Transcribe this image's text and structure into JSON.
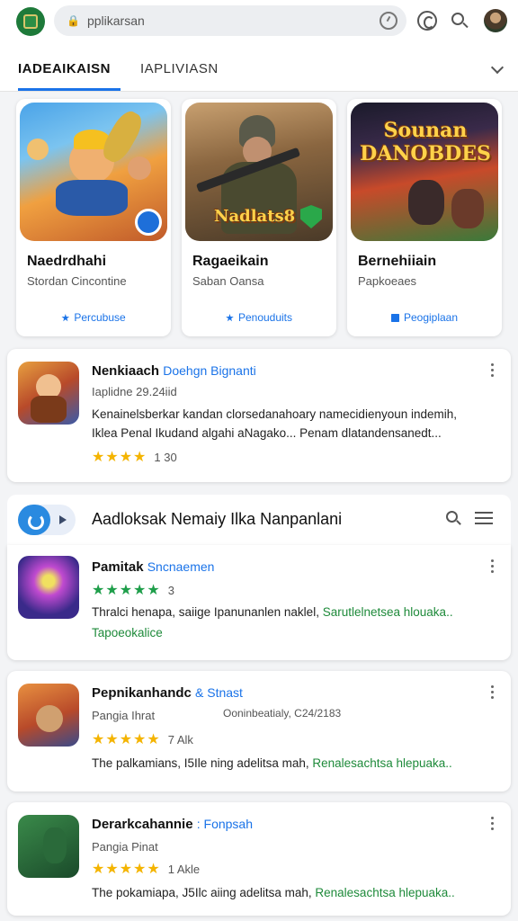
{
  "header": {
    "url": "pplikarsan"
  },
  "tabs": [
    {
      "label": "IADEAIKAISN"
    },
    {
      "label": "IAPLIVIASN"
    }
  ],
  "featured": [
    {
      "name": "Naedrdhahi",
      "sub": "Stordan Cincontine",
      "popular": "Percubuse",
      "icon": "star-icon",
      "art_title": ""
    },
    {
      "name": "Ragaeikain",
      "sub": "Saban Oansa",
      "popular": "Penouduits",
      "icon": "star-icon",
      "art_title": "Nadlats8"
    },
    {
      "name": "Bernehiiain",
      "sub": "Papkoeaes",
      "popular": "Peogiplaan",
      "icon": "grid-icon",
      "art_title": "Sounan DANOBDES"
    }
  ],
  "list_top": {
    "title": "Nenkiaach",
    "developer": "Doehgn Bignanti",
    "meta": "Iaplidne 29.24iid",
    "desc_line1": "Kenainelsberkar kandan clorsedanahoary namecidienyoun indemih,",
    "desc_line2": "Iklea Penal Ikudand algahi aNagako... Penam dlatandensanedt...",
    "stars": "★★★★",
    "rating": "1 30"
  },
  "section": {
    "title": "Aadloksak Nemaiy Ilka Nanpanlani"
  },
  "list_items": [
    {
      "title": "Pamitak",
      "developer": "Sncnaemen",
      "stars": "★★★★★",
      "star_color": "green",
      "rating": "3",
      "desc_plain": "Thralci henapa, saiige Ipanunanle",
      "desc_mid": "n naklel,",
      "desc_green": "Sarutlelnetsea hlouaka..",
      "tag": "Tapoeokalice"
    },
    {
      "title": "Pepnikanhandc",
      "developer": "& Stnast",
      "meta": "Pangia Ihrat",
      "meta_extra": "Ooninbeatialy, C24/2183",
      "stars": "★★★★★",
      "rating": "7 Alk",
      "desc_plain": "The palkamians, I5Ile ning adelitsa mah,",
      "desc_green": "Renalesachtsa hlepuaka.."
    },
    {
      "title": "Derarkcahannie",
      "developer": ": Fonpsah",
      "meta": "Pangia Pinat",
      "stars": "★★★★★",
      "rating": "1 Akle",
      "desc_plain": "The pokamiapa, J5Ilc aiing adelitsa mah,",
      "desc_green": "Renalesachtsa hlepuaka.."
    }
  ],
  "colors": {
    "accent": "#1a73e8",
    "green": "#1e8a3a",
    "star": "#f4b400"
  }
}
